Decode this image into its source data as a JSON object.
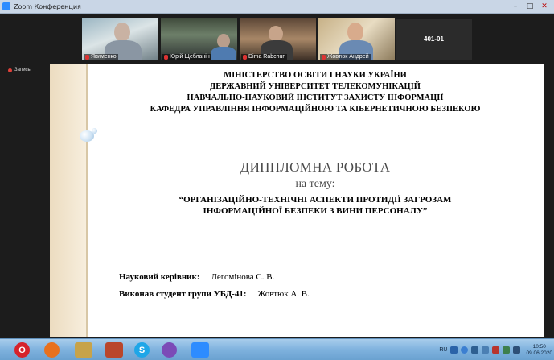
{
  "window": {
    "title": "Zoom Конференция",
    "controls": [
      "–",
      "□",
      "✕"
    ]
  },
  "participants": [
    {
      "name": "Якименко"
    },
    {
      "name": "Юрій Щебланін"
    },
    {
      "name": "Dima Rabchun"
    },
    {
      "name": "Жовтюк Андрей"
    }
  ],
  "counter": "401-01",
  "recording": {
    "label": "Запись"
  },
  "slide": {
    "header": [
      "МІНІСТЕРСТВО ОСВІТИ І НАУКИ УКРАЇНИ",
      "ДЕРЖАВНИЙ УНІВЕРСИТЕТ ТЕЛЕКОМУНІКАЦІЙ",
      "НАВЧАЛЬНО-НАУКОВИЙ ІНСТИТУТ ЗАХИСТУ ІНФОРМАЦІЇ",
      "КАФЕДРА УПРАВЛІННЯ ІНФОРМАЦІЙНОЮ ТА КІБЕРНЕТИЧНОЮ БЕЗПЕКОЮ"
    ],
    "thesis_title": "ДИППЛОМНА РОБОТА",
    "on_topic": "на тему:",
    "topic_lines": [
      "“ОРГАНІЗАЦІЙНО-ТЕХНІЧНІ АСПЕКТИ ПРОТИДІЇ ЗАГРОЗАМ",
      "ІНФОРМАЦІЙНОЇ БЕЗПЕКИ З ВИНИ ПЕРСОНАЛУ”"
    ],
    "supervisor_label": "Науковий керівник:",
    "supervisor_value": "Легомінова С. В.",
    "student_label": "Виконав студент групи УБД-41:",
    "student_value": "Жовтюк А. В."
  },
  "taskbar": {
    "apps": [
      {
        "icon": "opera-icon",
        "color": "#d6232b"
      },
      {
        "icon": "firefox-icon",
        "color": "#e8711e"
      },
      {
        "icon": "paint-icon",
        "color": "#c7a34a"
      },
      {
        "icon": "book-icon",
        "color": "#b9462c"
      },
      {
        "icon": "torch-icon",
        "color": "#2c3e5c"
      },
      {
        "icon": "skype-icon",
        "color": "#1ea6e8"
      },
      {
        "icon": "viber-icon",
        "color": "#7b4bb7"
      },
      {
        "icon": "zoom-icon",
        "color": "#2d8cff"
      }
    ],
    "lang": "RU",
    "time": "10:50",
    "date": "09.06.2020"
  }
}
